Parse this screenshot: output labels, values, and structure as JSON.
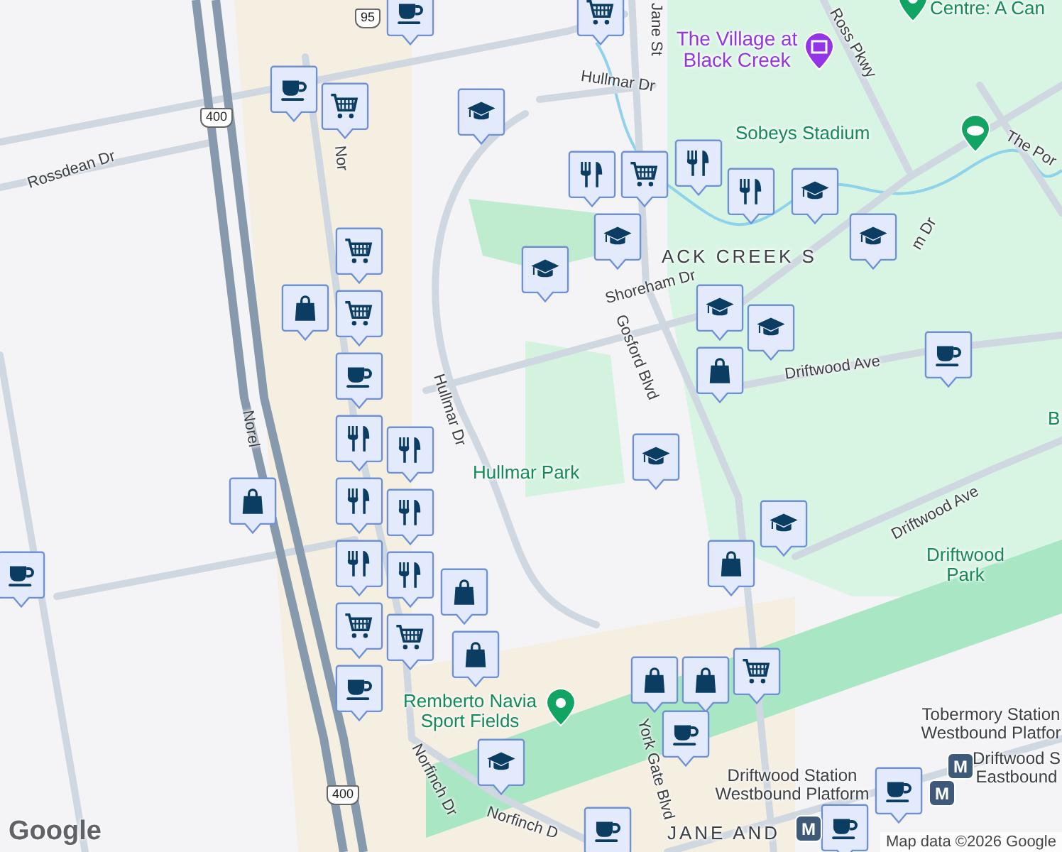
{
  "map": {
    "labels": [
      {
        "text": "Jane St",
        "kind": "road"
      },
      {
        "text": "The Village at Black Creek",
        "kind": "museum"
      },
      {
        "text": "Centre: A Can",
        "kind": "park"
      },
      {
        "text": "Ross Pkwy",
        "kind": "road"
      },
      {
        "text": "Hullmar Dr",
        "kind": "road"
      },
      {
        "text": "Sobeys Stadium",
        "kind": "park"
      },
      {
        "text": "The Por",
        "kind": "road"
      },
      {
        "text": "ACK CREEK S",
        "kind": "area"
      },
      {
        "text": "m Dr",
        "kind": "road"
      },
      {
        "text": "Shoreham Dr",
        "kind": "road"
      },
      {
        "text": "Gosford Blvd",
        "kind": "road"
      },
      {
        "text": "Driftwood Ave",
        "kind": "road"
      },
      {
        "text": "Driftwood Ave",
        "kind": "road"
      },
      {
        "text": "Driftwood Park",
        "kind": "park"
      },
      {
        "text": "B",
        "kind": "park"
      },
      {
        "text": "Hullmar Park",
        "kind": "park"
      },
      {
        "text": "Hullmar Dr",
        "kind": "road"
      },
      {
        "text": "Rossdean Dr",
        "kind": "road"
      },
      {
        "text": "Nor",
        "kind": "road"
      },
      {
        "text": "Norel",
        "kind": "road"
      },
      {
        "text": "Norfinch Dr",
        "kind": "road"
      },
      {
        "text": "Norfinch D",
        "kind": "road"
      },
      {
        "text": "Remberto Navia Sport Fields",
        "kind": "park"
      },
      {
        "text": "York Gate Blvd",
        "kind": "road"
      },
      {
        "text": "Tobermory Station Westbound Platfor",
        "kind": "transit"
      },
      {
        "text": "Driftwood Station Westbound Platform",
        "kind": "transit"
      },
      {
        "text": "Driftwood S Eastbound",
        "kind": "transit"
      },
      {
        "text": "JANE AND",
        "kind": "area"
      },
      {
        "text": "400",
        "kind": "shield"
      },
      {
        "text": "400",
        "kind": "shield"
      },
      {
        "text": "95",
        "kind": "shield"
      }
    ],
    "places": [
      {
        "kind": "museum"
      },
      {
        "kind": "stadium"
      },
      {
        "kind": "park"
      },
      {
        "kind": "park"
      }
    ],
    "transit_stops": [
      {
        "text": "M"
      },
      {
        "text": "M"
      },
      {
        "text": "M"
      }
    ],
    "markers": [
      {
        "kind": "cafe"
      },
      {
        "kind": "cart"
      },
      {
        "kind": "cafe"
      },
      {
        "kind": "cart"
      },
      {
        "kind": "school"
      },
      {
        "kind": "food"
      },
      {
        "kind": "cart"
      },
      {
        "kind": "food"
      },
      {
        "kind": "school"
      },
      {
        "kind": "school"
      },
      {
        "kind": "school"
      },
      {
        "kind": "school"
      },
      {
        "kind": "cart"
      },
      {
        "kind": "bag"
      },
      {
        "kind": "cart"
      },
      {
        "kind": "cafe"
      },
      {
        "kind": "food"
      },
      {
        "kind": "food"
      },
      {
        "kind": "food"
      },
      {
        "kind": "food"
      },
      {
        "kind": "cart"
      },
      {
        "kind": "cafe"
      },
      {
        "kind": "cart"
      },
      {
        "kind": "bag"
      },
      {
        "kind": "bag"
      },
      {
        "kind": "bag"
      },
      {
        "kind": "school"
      },
      {
        "kind": "school"
      },
      {
        "kind": "bag"
      },
      {
        "kind": "cafe"
      },
      {
        "kind": "school"
      },
      {
        "kind": "cafe"
      },
      {
        "kind": "school"
      },
      {
        "kind": "bag"
      },
      {
        "kind": "bag"
      },
      {
        "kind": "cart"
      },
      {
        "kind": "cafe"
      },
      {
        "kind": "school"
      },
      {
        "kind": "cafe"
      },
      {
        "kind": "cafe"
      },
      {
        "kind": "food"
      },
      {
        "kind": "food"
      },
      {
        "kind": "food"
      },
      {
        "kind": "bag"
      },
      {
        "kind": "cafe"
      }
    ]
  },
  "logo": "Google",
  "attribution": "Map data ©2026 Google"
}
